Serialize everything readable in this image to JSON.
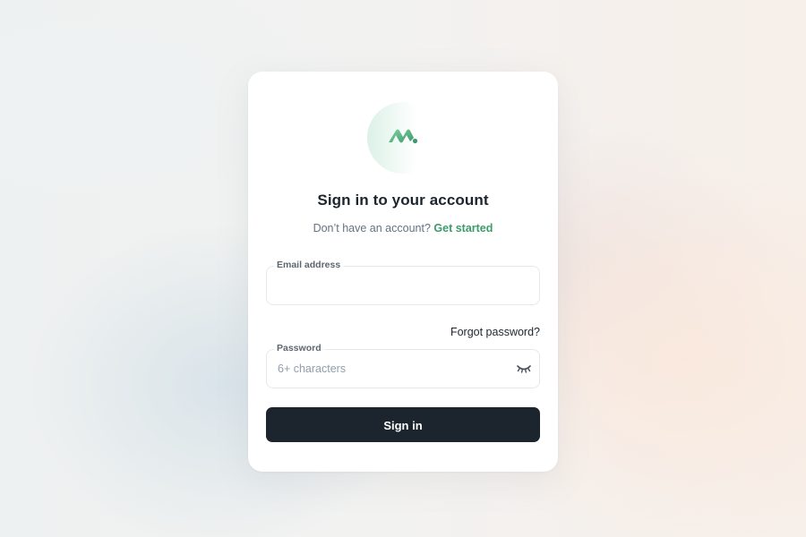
{
  "brand": {
    "logo_icon": "brand-logo-icon",
    "accent_color": "#3d9a6a",
    "logo_colors": [
      "#6cc28d",
      "#3d9a6a"
    ]
  },
  "form": {
    "title": "Sign in to your account",
    "subtitle_text": "Don’t have an account?",
    "subtitle_link": "Get started",
    "email": {
      "label": "Email address",
      "value": "",
      "placeholder": ""
    },
    "forgot_password": "Forgot password?",
    "password": {
      "label": "Password",
      "value": "",
      "placeholder": "6+ characters",
      "toggle_icon": "eye-closed-icon"
    },
    "submit_label": "Sign in",
    "button_color": "#1c252e"
  }
}
